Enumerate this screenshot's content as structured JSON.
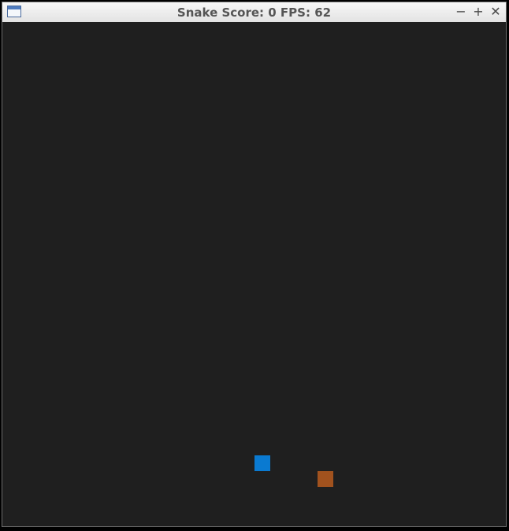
{
  "window": {
    "title": "Snake Score: 0 FPS: 62",
    "icon": "window-app-icon",
    "controls": {
      "minimize": "−",
      "maximize": "+",
      "close": "✕"
    }
  },
  "game": {
    "score": 0,
    "fps": 62,
    "background_color": "#1f1f1f",
    "snake_color": "#0a7ad1",
    "food_color": "#a1521e"
  }
}
